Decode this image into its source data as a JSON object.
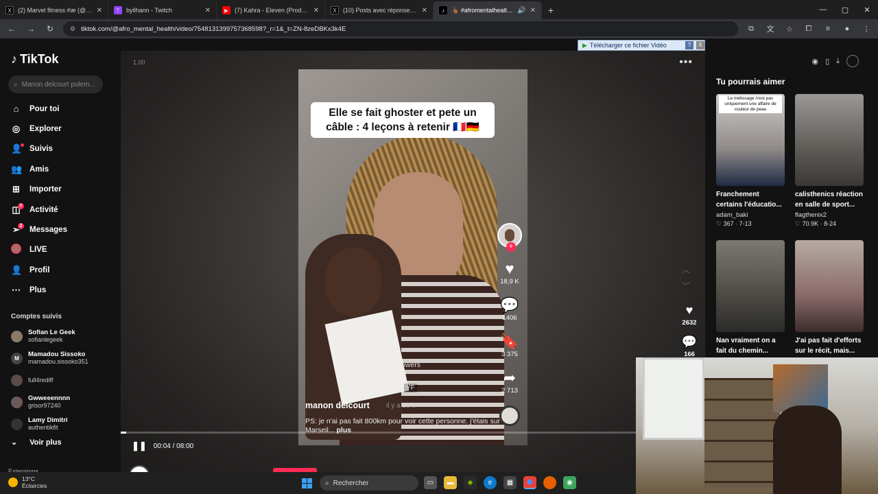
{
  "browser": {
    "tabs": [
      {
        "title": "(2) Marvel fitness #æ (@Marvel_",
        "favicon": "X",
        "color": "#000000"
      },
      {
        "title": "byilhann - Twitch",
        "favicon": "T",
        "color": "#9146ff"
      },
      {
        "title": "(7) Kahra - Eleven (Prod. @_Tric",
        "favicon": "▶",
        "color": "#ff0000"
      },
      {
        "title": "(10) Posts avec réponses de Bo",
        "favicon": "X",
        "color": "#000000"
      },
      {
        "title": "👆🏾 #afromentalhealth #a",
        "favicon": "♪",
        "color": "#000000",
        "active": true
      }
    ],
    "new_tab": "+",
    "url": "tiktok.com/@afro_mental_health/video/7548131399757368598?_r=1&_t=ZN-8zeDBKx3k4E"
  },
  "sidebar": {
    "logo": "TikTok",
    "search_placeholder": "Manon delcourt polem...",
    "nav": [
      {
        "label": "Pour toi",
        "icon": "home-icon"
      },
      {
        "label": "Explorer",
        "icon": "compass-icon"
      },
      {
        "label": "Suivis",
        "icon": "following-icon",
        "dot": true
      },
      {
        "label": "Amis",
        "icon": "friends-icon"
      },
      {
        "label": "Importer",
        "icon": "upload-icon"
      },
      {
        "label": "Activité",
        "icon": "activity-icon",
        "badge": "7"
      },
      {
        "label": "Messages",
        "icon": "messages-icon",
        "badge": "2"
      },
      {
        "label": "LIVE",
        "icon": "live-icon"
      },
      {
        "label": "Profil",
        "icon": "profile-icon"
      },
      {
        "label": "Plus",
        "icon": "more-icon"
      }
    ],
    "following_title": "Comptes suivis",
    "following": [
      {
        "name": "Sofian Le Geek",
        "user": "sofianlegeek"
      },
      {
        "name": "Mamadou Sissoko",
        "user": "mamadou.sissoko351",
        "initial": "M"
      },
      {
        "name": "",
        "user": "full4rediff"
      },
      {
        "name": "Gwweeennnn",
        "user": "grisor97240"
      },
      {
        "name": "Lamy Dimitri",
        "user": "authentikfit"
      }
    ],
    "see_more": "Voir plus",
    "extensions_label": "Extensions"
  },
  "video": {
    "counter": "1.00",
    "caption": "Elle se fait ghoster et pete un câble : 4 leçons à retenir 🇫🇷🇩🇪",
    "overlay_followers": "owers",
    "overlay_tag": "YF",
    "author": "manon delcourt",
    "time_ago": "il y a 16 h",
    "description": "PS: je n'ai pas fait 800km pour voir cette personne. j'étais sur Marseil...",
    "more": "plus",
    "likes": "18,9 K",
    "comments": "1406",
    "saves": "3 375",
    "shares": "2 713",
    "time_current": "00:04",
    "time_total": "08:00",
    "progress": 0.01
  },
  "page_actions": {
    "likes": "2632",
    "comments": "166"
  },
  "below": {
    "author": "afro_mental_health"
  },
  "download_banner": {
    "label": "Télécharger ce fichier Vidéo",
    "help": "?",
    "close": "X"
  },
  "right_panel": {
    "title": "Tu pourrais aimer",
    "cards": [
      {
        "title": "Franchement certains l'éducatio...",
        "user": "adam_baki",
        "likes": "367",
        "date": "7-13",
        "thumb_text": "Le métissage n'est pas uniquement une affaire de couleur de peau",
        "color": "#c9c5c4"
      },
      {
        "title": "calisthenics réaction en salle de sport...",
        "user": "flagthenix2",
        "likes": "70.9K",
        "date": "8-24",
        "thumb_text": "",
        "color": "#8a8682"
      },
      {
        "title": "Nan vraiment on a fait du chemin...",
        "user": "",
        "likes": "",
        "date": "",
        "thumb_text": "",
        "color": "#6f6a62"
      },
      {
        "title": "J'ai pas fait d'efforts sur le récit, mais...",
        "user": "",
        "likes": "",
        "date": "",
        "thumb_text": "",
        "color": "#9a8d86"
      }
    ]
  },
  "taskbar": {
    "temp": "13°C",
    "weather": "Éclaircies",
    "search": "Rechercher"
  }
}
